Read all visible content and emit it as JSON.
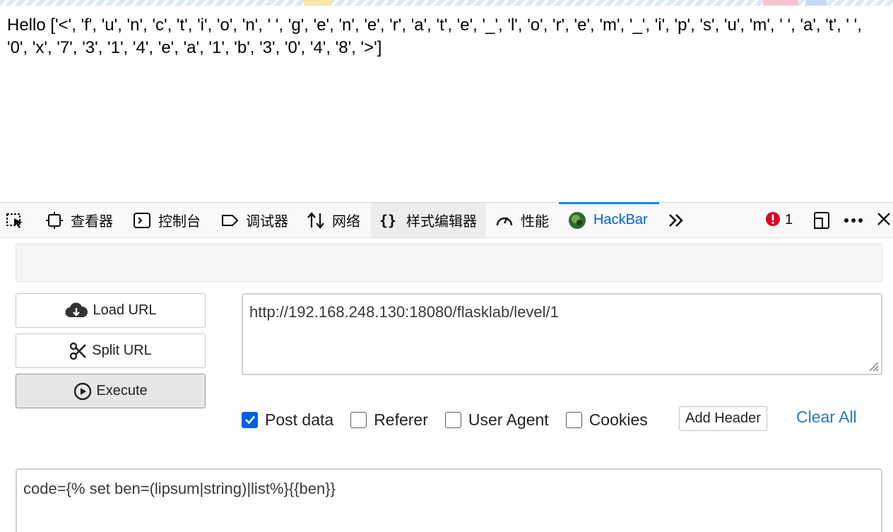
{
  "page": {
    "body_text": "Hello ['<', 'f', 'u', 'n', 'c', 't', 'i', 'o', 'n', ' ', 'g', 'e', 'n', 'e', 'r', 'a', 't', 'e', '_', 'l', 'o', 'r', 'e', 'm', '_', 'i', 'p', 's', 'u', 'm', ' ', 'a', 't', ' ', '0', 'x', '7', '3', '1', '4', 'e', 'a', '1', 'b', '3', '0', '4', '8', '>']"
  },
  "devtools": {
    "tabs": [
      {
        "label": "",
        "icon": "inspect-pointer-icon"
      },
      {
        "label": "查看器",
        "icon": "inspector-icon"
      },
      {
        "label": "控制台",
        "icon": "console-icon"
      },
      {
        "label": "调试器",
        "icon": "debugger-icon"
      },
      {
        "label": "网络",
        "icon": "network-icon"
      },
      {
        "label": "样式编辑器",
        "icon": "style-editor-icon"
      },
      {
        "label": "性能",
        "icon": "performance-icon"
      },
      {
        "label": "HackBar",
        "icon": "hackbar-logo-icon"
      }
    ],
    "active_tab": "HackBar",
    "error_count": "1",
    "colors": {
      "accent": "#0a84ff",
      "error": "#d70022",
      "link": "#2a77c4"
    }
  },
  "hackbar": {
    "buttons": {
      "load_url": "Load URL",
      "split_url": "Split URL",
      "execute": "Execute"
    },
    "url_value": "http://192.168.248.130:18080/flasklab/level/1",
    "options": [
      {
        "label": "Post data",
        "checked": true
      },
      {
        "label": "Referer",
        "checked": false
      },
      {
        "label": "User Agent",
        "checked": false
      },
      {
        "label": "Cookies",
        "checked": false
      }
    ],
    "add_header": "Add Header",
    "clear_all": "Clear All",
    "post_value": "code={% set ben=(lipsum|string)|list%}{{ben}}"
  }
}
